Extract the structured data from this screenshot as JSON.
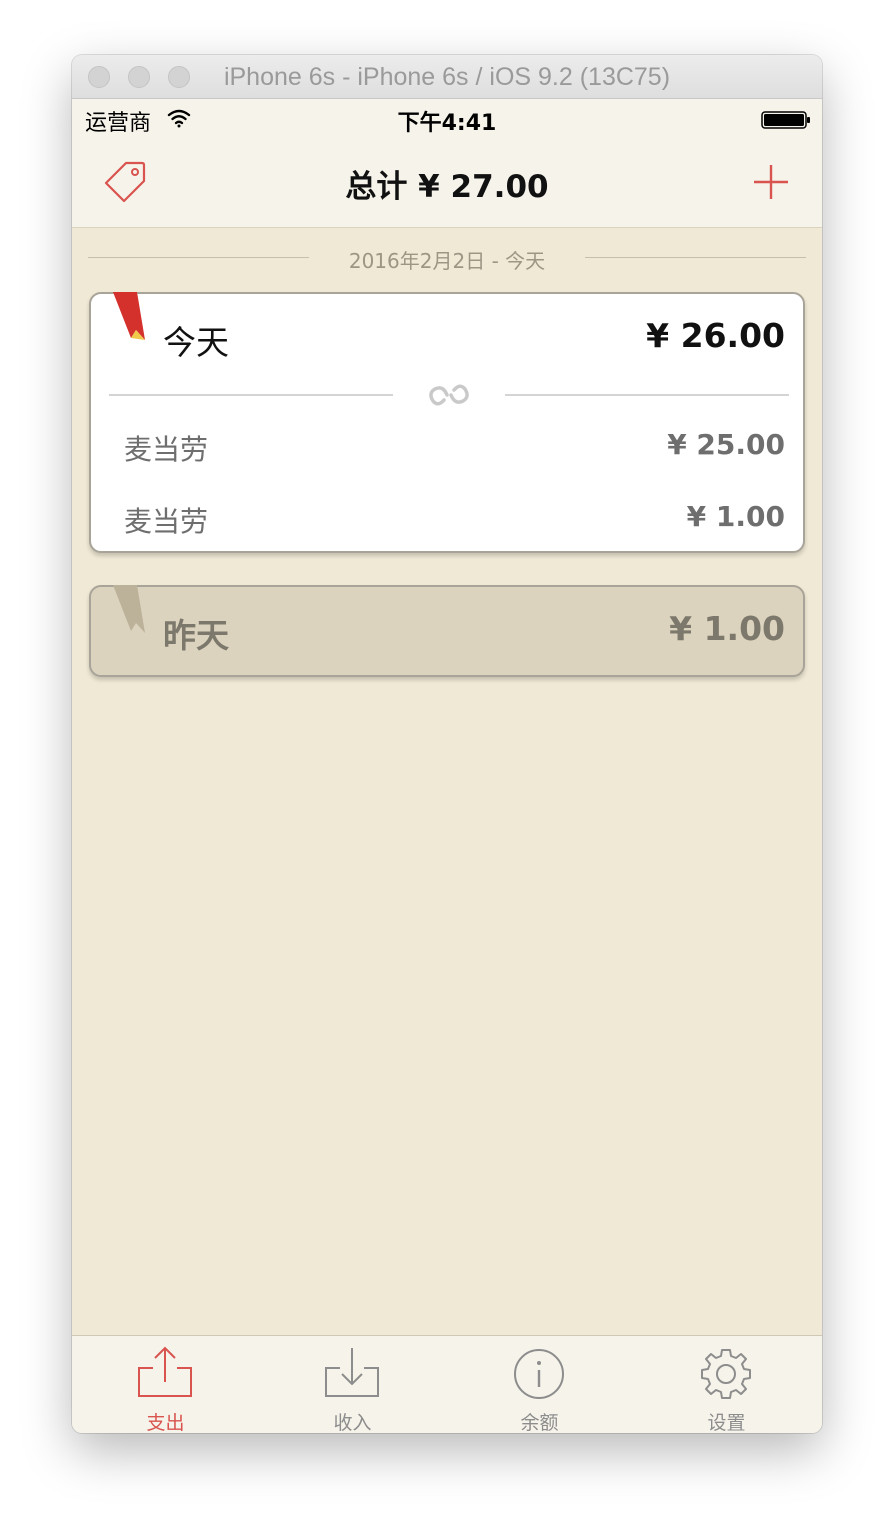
{
  "window": {
    "title": "iPhone 6s - iPhone 6s / iOS 9.2 (13C75)"
  },
  "status_bar": {
    "carrier": "运营商",
    "time": "下午4:41"
  },
  "nav": {
    "title": "总计 ¥ 27.00",
    "left_icon": "tag-icon",
    "right_icon": "plus-icon"
  },
  "date_header": "2016年2月2日 - 今天",
  "today_card": {
    "title": "今天",
    "total": "¥ 26.00",
    "entries": [
      {
        "name": "麦当劳",
        "amount": "¥ 25.00"
      },
      {
        "name": "麦当劳",
        "amount": "¥ 1.00"
      }
    ]
  },
  "yesterday_card": {
    "title": "昨天",
    "total": "¥ 1.00"
  },
  "tabbar": {
    "tabs": [
      {
        "label": "支出",
        "icon": "share-out-icon",
        "active": true
      },
      {
        "label": "收入",
        "icon": "download-in-icon",
        "active": false
      },
      {
        "label": "余额",
        "icon": "info-icon",
        "active": false
      },
      {
        "label": "设置",
        "icon": "gear-icon",
        "active": false
      }
    ]
  },
  "colors": {
    "accent": "#d9534f",
    "background": "#f0e9d5",
    "bar_background": "#f6f3ea",
    "collapsed_card": "#dbd3be"
  }
}
